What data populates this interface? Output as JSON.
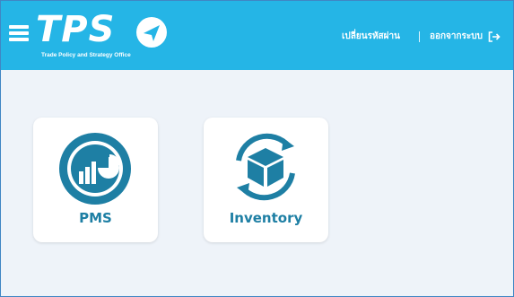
{
  "header": {
    "logo_text": "TPS",
    "logo_subtitle": "Trade Policy and Strategy Office",
    "change_password_label": "เปลี่ยนรหัสผ่าน",
    "logout_label": "ออกจากระบบ"
  },
  "apps": [
    {
      "label": "PMS",
      "icon": "pms-chart-icon"
    },
    {
      "label": "Inventory",
      "icon": "inventory-box-icon"
    }
  ],
  "colors": {
    "header_bg": "#25b5e6",
    "page_bg": "#eef3f9",
    "icon_color": "#1e7fa4"
  }
}
